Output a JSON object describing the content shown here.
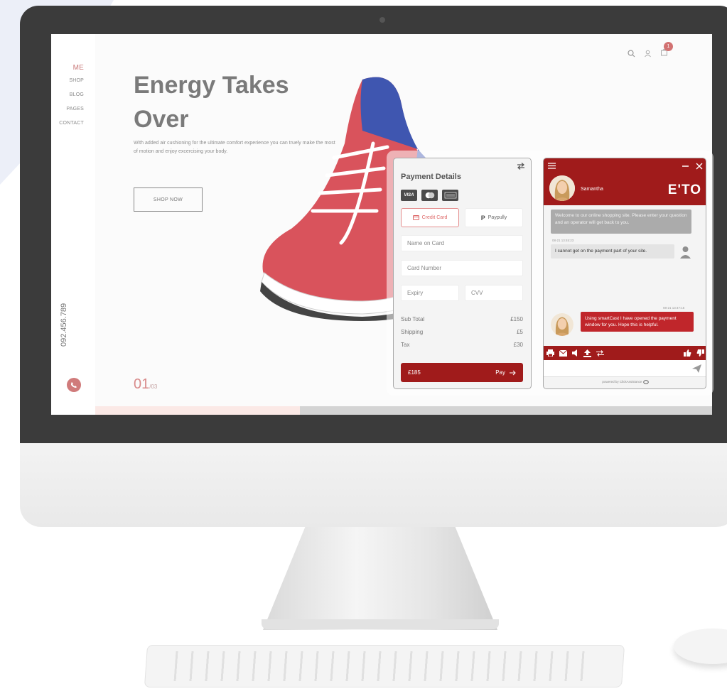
{
  "nav": {
    "items": [
      "ME",
      "SHOP",
      "BLOG",
      "PAGES",
      "CONTACT"
    ]
  },
  "contact": {
    "phone": "092.456.789"
  },
  "hero": {
    "title": "Energy Takes Over",
    "description": "With added air cushioning for the ultimate comfort experience you can truely make the most of motion and enjoy excercising your body.",
    "cta": "SHOP NOW",
    "slide_current": "01",
    "slide_total": "/03"
  },
  "header_icons": [
    "search-icon",
    "user-icon",
    "cart-icon"
  ],
  "cart": {
    "count": "1"
  },
  "payment": {
    "title": "Payment Details",
    "card_brands": [
      "VISA",
      "mastercard",
      "amex"
    ],
    "methods": {
      "credit": "Credit Card",
      "paypal": "Paypully",
      "paypal_symbol": "P"
    },
    "placeholders": {
      "name": "Name on Card",
      "number": "Card Number",
      "expiry": "Expiry",
      "cvv": "CVV"
    },
    "summary": [
      {
        "label": "Sub Total",
        "value": "£150"
      },
      {
        "label": "Shipping",
        "value": "£5"
      },
      {
        "label": "Tax",
        "value": "£30"
      }
    ],
    "total": "£185",
    "pay_label": "Pay"
  },
  "chat": {
    "agent_name": "Samantha",
    "brand": "E'TO",
    "messages": {
      "operator_welcome": "Welcome to our online shopping site. Please enter your question and an operator will get back to you.",
      "user_time": "08-21 13:45:23",
      "user_msg": "I cannot get on the payment part of your site.",
      "agent_time": "08-21 13:47:15",
      "agent_msg": "Using smartCast I have opened the payment window for you. Hope this is helpful."
    },
    "powered_by": "powered by ClickAssistance"
  },
  "colors": {
    "brand_red": "#a01b1b",
    "accent_pink": "#d07b7b",
    "agent_bubble": "#c0262b"
  }
}
